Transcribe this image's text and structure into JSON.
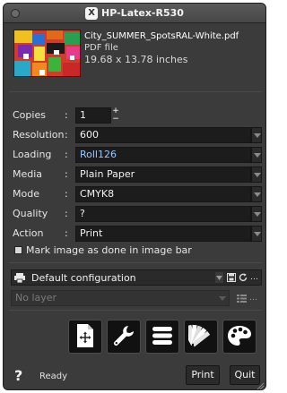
{
  "window": {
    "title": "HP-Latex-R530"
  },
  "file": {
    "name": "City_SUMMER_SpotsRAL-White.pdf",
    "type": "PDF file",
    "size": "19.68 x 13.78 inches"
  },
  "settings": {
    "copies": {
      "label": "Copies",
      "value": "1"
    },
    "resolution": {
      "label": "Resolution",
      "value": "600"
    },
    "loading": {
      "label": "Loading",
      "value": "Roll126"
    },
    "media": {
      "label": "Media",
      "value": "Plain Paper"
    },
    "mode": {
      "label": "Mode",
      "value": "CMYK8"
    },
    "quality": {
      "label": "Quality",
      "value": "?"
    },
    "action": {
      "label": "Action",
      "value": "Print"
    }
  },
  "checkbox": {
    "label": "Mark image as done in image bar",
    "checked": false
  },
  "configuration": {
    "value": "Default configuration"
  },
  "layer": {
    "placeholder": "No layer"
  },
  "toolbar": {
    "icons": [
      "document-position-icon",
      "wrench-icon",
      "list-icon",
      "swatch-fan-icon",
      "palette-icon"
    ]
  },
  "footer": {
    "help": "?",
    "status": "Ready",
    "print_label": "Print",
    "quit_label": "Quit"
  },
  "colors": {
    "window_bg": "#3b3b3b",
    "field_bg": "#1c1c1c",
    "accent_text": "#9bc8ff"
  }
}
